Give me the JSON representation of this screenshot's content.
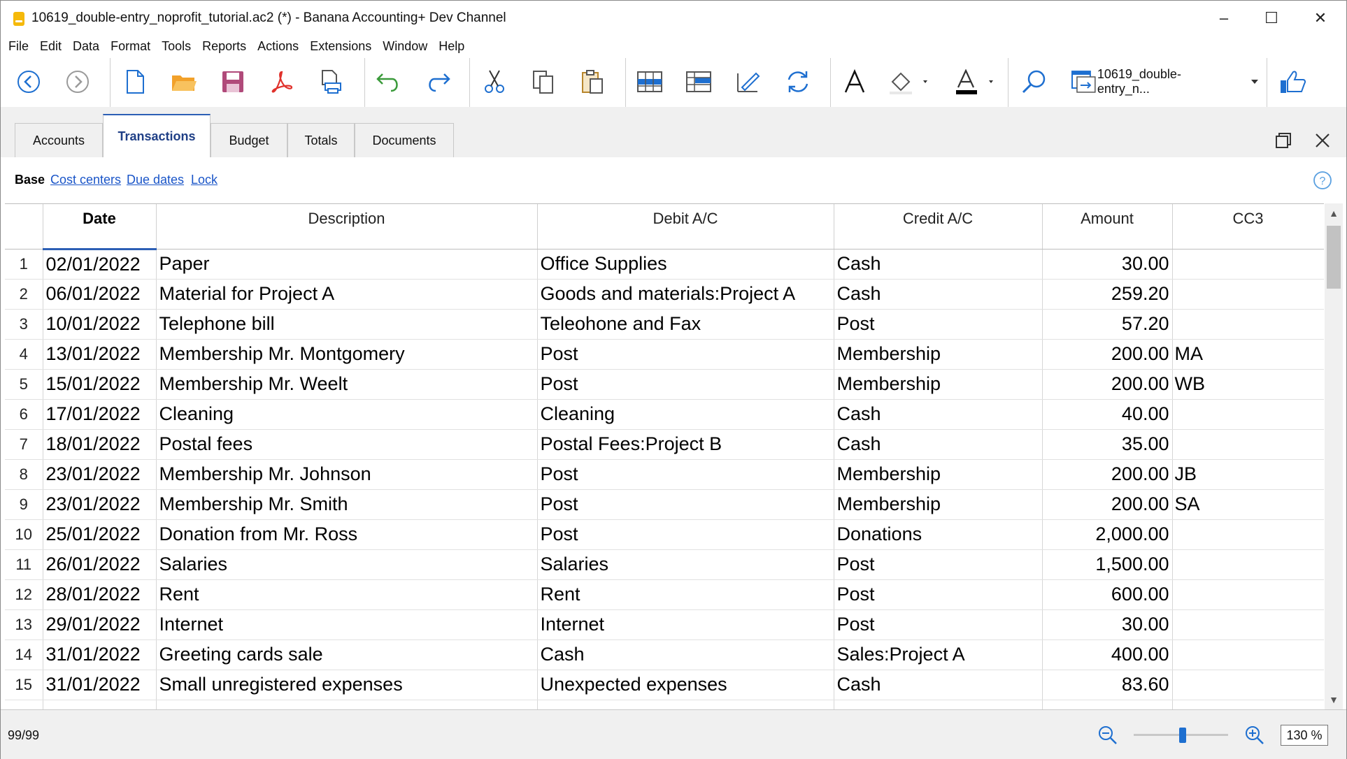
{
  "window": {
    "title": "10619_double-entry_noprofit_tutorial.ac2 (*) - Banana Accounting+ Dev Channel",
    "minimize_glyph": "–",
    "maximize_glyph": "☐",
    "close_glyph": "✕"
  },
  "menu": [
    "File",
    "Edit",
    "Data",
    "Format",
    "Tools",
    "Reports",
    "Actions",
    "Extensions",
    "Window",
    "Help"
  ],
  "toolbar": {
    "file_selector": "10619_double-entry_n...",
    "icons": [
      "back-icon",
      "forward-icon",
      "new-file-icon",
      "open-folder-icon",
      "save-icon",
      "pdf-icon",
      "print-preview-icon",
      "undo-icon",
      "redo-icon",
      "cut-icon",
      "copy-icon",
      "paste-icon",
      "insert-rows-icon",
      "add-rows-icon",
      "edit-icon",
      "recheck-icon",
      "font-icon",
      "fill-color-icon",
      "text-color-icon",
      "search-icon",
      "window-selector-icon",
      "feedback-thumbs-up-icon"
    ]
  },
  "tabs": [
    "Accounts",
    "Transactions",
    "Budget",
    "Totals",
    "Documents"
  ],
  "active_tab": "Transactions",
  "views": {
    "current": "Base",
    "links": [
      "Cost centers",
      "Due dates",
      "Lock"
    ]
  },
  "table": {
    "columns": [
      "Date",
      "Description",
      "Debit A/C",
      "Credit A/C",
      "Amount",
      "CC3"
    ],
    "rows": [
      {
        "n": "1",
        "date": "02/01/2022",
        "desc": "Paper",
        "debit": "Office Supplies",
        "credit": "Cash",
        "amount": "30.00",
        "cc3": ""
      },
      {
        "n": "2",
        "date": "06/01/2022",
        "desc": "Material for Project A",
        "debit": "Goods and materials:Project A",
        "credit": "Cash",
        "amount": "259.20",
        "cc3": ""
      },
      {
        "n": "3",
        "date": "10/01/2022",
        "desc": "Telephone bill",
        "debit": "Teleohone and Fax",
        "credit": "Post",
        "amount": "57.20",
        "cc3": ""
      },
      {
        "n": "4",
        "date": "13/01/2022",
        "desc": "Membership Mr. Montgomery",
        "debit": "Post",
        "credit": "Membership",
        "amount": "200.00",
        "cc3": "MA"
      },
      {
        "n": "5",
        "date": "15/01/2022",
        "desc": "Membership  Mr. Weelt",
        "debit": "Post",
        "credit": "Membership",
        "amount": "200.00",
        "cc3": "WB"
      },
      {
        "n": "6",
        "date": "17/01/2022",
        "desc": "Cleaning",
        "debit": "Cleaning",
        "credit": "Cash",
        "amount": "40.00",
        "cc3": ""
      },
      {
        "n": "7",
        "date": "18/01/2022",
        "desc": "Postal fees",
        "debit": "Postal Fees:Project B",
        "credit": "Cash",
        "amount": "35.00",
        "cc3": ""
      },
      {
        "n": "8",
        "date": "23/01/2022",
        "desc": "Membership  Mr. Johnson",
        "debit": "Post",
        "credit": "Membership",
        "amount": "200.00",
        "cc3": "JB"
      },
      {
        "n": "9",
        "date": "23/01/2022",
        "desc": "Membership  Mr. Smith",
        "debit": "Post",
        "credit": "Membership",
        "amount": "200.00",
        "cc3": "SA"
      },
      {
        "n": "10",
        "date": "25/01/2022",
        "desc": "Donation from Mr. Ross",
        "debit": "Post",
        "credit": "Donations",
        "amount": "2,000.00",
        "cc3": ""
      },
      {
        "n": "11",
        "date": "26/01/2022",
        "desc": "Salaries",
        "debit": "Salaries",
        "credit": "Post",
        "amount": "1,500.00",
        "cc3": ""
      },
      {
        "n": "12",
        "date": "28/01/2022",
        "desc": "Rent",
        "debit": "Rent",
        "credit": "Post",
        "amount": "600.00",
        "cc3": ""
      },
      {
        "n": "13",
        "date": "29/01/2022",
        "desc": "Internet",
        "debit": "Internet",
        "credit": "Post",
        "amount": "30.00",
        "cc3": ""
      },
      {
        "n": "14",
        "date": "31/01/2022",
        "desc": "Greeting cards sale",
        "debit": "Cash",
        "credit": "Sales:Project A",
        "amount": "400.00",
        "cc3": ""
      },
      {
        "n": "15",
        "date": "31/01/2022",
        "desc": "Small unregistered expenses",
        "debit": "Unexpected expenses",
        "credit": "Cash",
        "amount": "83.60",
        "cc3": ""
      }
    ]
  },
  "status": {
    "record_count": "99/99",
    "zoom": "130 %",
    "zoom_slider_level": 0.52
  },
  "colors": {
    "accent": "#2d5fb5",
    "link": "#1a55c8",
    "tab_active_text": "#1f3f86",
    "toolbar_blue": "#1e6fd0",
    "save_icon": "#b04a7a",
    "pdf_icon": "#e0312b",
    "undo_green": "#3a9a3a",
    "folder_orange": "#f2a12a",
    "logo_yellow": "#f5b90a"
  }
}
